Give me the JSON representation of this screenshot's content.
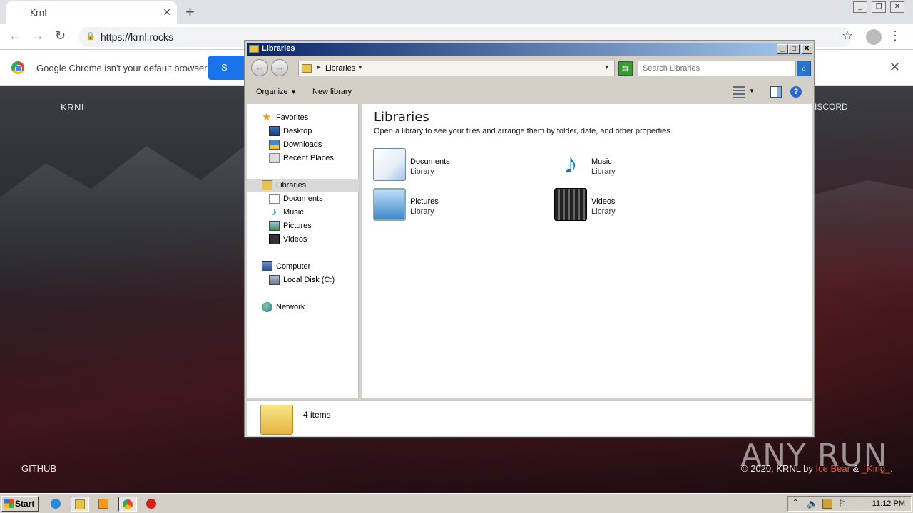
{
  "browser": {
    "tab_title": "Krnl",
    "tab_close": "✕",
    "new_tab": "+",
    "url": "https://krnl.rocks",
    "infobar_message": "Google Chrome isn't your default browser",
    "infobar_button": "S",
    "infobar_close": "✕"
  },
  "website": {
    "brand": "KRNL",
    "nav_right": "ISCORD",
    "footer_left": "GITHUB",
    "copyright_prefix": "© 2020, KRNL by ",
    "author1": "Ice Bear",
    "and": " & ",
    "author2": "_King_",
    "end": ".",
    "watermark": "ANY RUN"
  },
  "explorer": {
    "title": "Libraries",
    "address_crumb": "Libraries",
    "search_placeholder": "Search Libraries",
    "toolbar": {
      "organize": "Organize",
      "new_library": "New library",
      "help": "?"
    },
    "nav": {
      "favorites": "Favorites",
      "desktop": "Desktop",
      "downloads": "Downloads",
      "recent_places": "Recent Places",
      "libraries": "Libraries",
      "documents": "Documents",
      "music": "Music",
      "pictures": "Pictures",
      "videos": "Videos",
      "computer": "Computer",
      "local_disk": "Local Disk (C:)",
      "network": "Network"
    },
    "content": {
      "heading": "Libraries",
      "subtitle": "Open a library to see your files and arrange them by folder, date, and other properties.",
      "libraries": [
        {
          "name": "Documents",
          "type": "Library"
        },
        {
          "name": "Music",
          "type": "Library"
        },
        {
          "name": "Pictures",
          "type": "Library"
        },
        {
          "name": "Videos",
          "type": "Library"
        }
      ]
    },
    "details": {
      "count": "4 items"
    }
  },
  "taskbar": {
    "start": "Start",
    "clock": "11:12 PM"
  }
}
